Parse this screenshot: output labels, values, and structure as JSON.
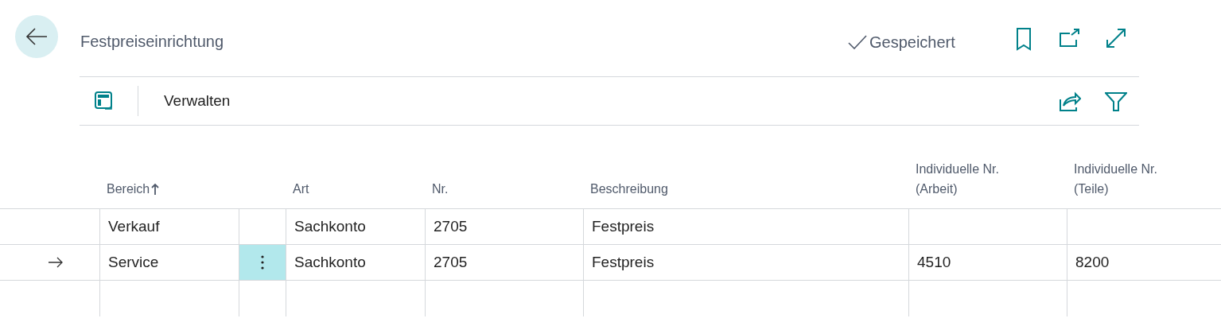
{
  "page": {
    "title": "Festpreiseinrichtung",
    "save_status": "Gespeichert"
  },
  "action_bar": {
    "items": [
      {
        "label": "Verwalten"
      }
    ]
  },
  "table": {
    "columns": [
      {
        "label": "Bereich",
        "sorted": true
      },
      {
        "label": "Art",
        "sorted": false
      },
      {
        "label": "Nr.",
        "sorted": false
      },
      {
        "label": "Beschreibung",
        "sorted": false
      },
      {
        "label": "Individuelle Nr. (Arbeit)",
        "sorted": false
      },
      {
        "label": "Individuelle Nr. (Teile)",
        "sorted": false
      }
    ],
    "rows": [
      {
        "selected": false,
        "cells": [
          "Verkauf",
          "Sachkonto",
          "2705",
          "Festpreis",
          null,
          null
        ]
      },
      {
        "selected": true,
        "cells": [
          "Service",
          "Sachkonto",
          "2705",
          "Festpreis",
          "4510",
          "8200"
        ]
      }
    ]
  }
}
